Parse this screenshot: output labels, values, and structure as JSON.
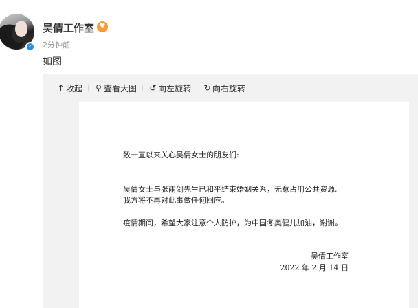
{
  "post": {
    "user_name": "吴倩工作室",
    "time": "2分钟前",
    "text": "如图"
  },
  "badges": {
    "verified_icon": "verified-icon",
    "fan_icon": "fan-badge-icon"
  },
  "toolbar": {
    "collapse_label": "收起",
    "view_large_label": "查看大图",
    "rotate_left_label": "向左旋转",
    "rotate_right_label": "向右旋转"
  },
  "document": {
    "greeting": "致一直以来关心吴倩女士的朋友们:",
    "para1_line1": "吴倩女士与张雨剑先生已和平结束婚姻关系，无意占用公共资源,",
    "para1_line2": "我方将不再对此事做任何回应。",
    "para2": "疫情期间，希望大家注意个人防护，为中国冬奥健儿加油，谢谢。",
    "signature": "吴倩工作室",
    "date": "2022 年 2 月 14 日"
  },
  "colors": {
    "verified": "#1d8df2",
    "fan_badge": "#ff9a2e",
    "panel_bg": "#f2f2f2",
    "meta_text": "#939393"
  }
}
